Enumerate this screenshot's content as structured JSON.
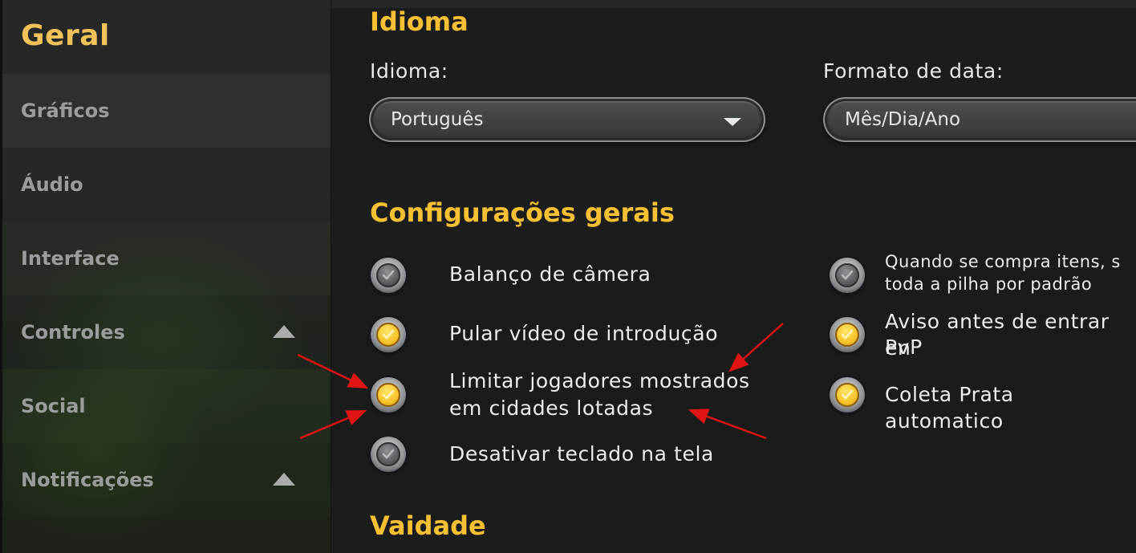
{
  "sidebar": {
    "active": "Geral",
    "items": [
      "Gráficos",
      "Áudio",
      "Interface",
      "Controles",
      "Social",
      "Notificações"
    ]
  },
  "language_section": {
    "title": "Idioma",
    "language_label": "Idioma:",
    "language_value": "Português",
    "date_label": "Formato de data:",
    "date_value": "Mês/Dia/Ano"
  },
  "general_section": {
    "title": "Configurações gerais",
    "options_left": [
      {
        "label_lines": [
          "Balanço de câmera"
        ],
        "checked": false
      },
      {
        "label_lines": [
          "Pular vídeo de introdução"
        ],
        "checked": true
      },
      {
        "label_lines": [
          "Limitar jogadores mostrados",
          "em cidades lotadas"
        ],
        "checked": true
      },
      {
        "label_lines": [
          "Desativar teclado na tela"
        ],
        "checked": false
      }
    ],
    "options_right": [
      {
        "label_lines": [
          "Quando se compra itens, s",
          "toda a pilha por padrão"
        ],
        "checked": false
      },
      {
        "label_lines": [
          "Aviso antes de entrar en",
          "PvP"
        ],
        "checked": true
      },
      {
        "label_lines": [
          "Coleta Prata automatico"
        ],
        "checked": true
      }
    ]
  },
  "vanity_section": {
    "title": "Vaidade"
  },
  "colors": {
    "accent": "#f7c133",
    "arrow": "#e01414"
  }
}
